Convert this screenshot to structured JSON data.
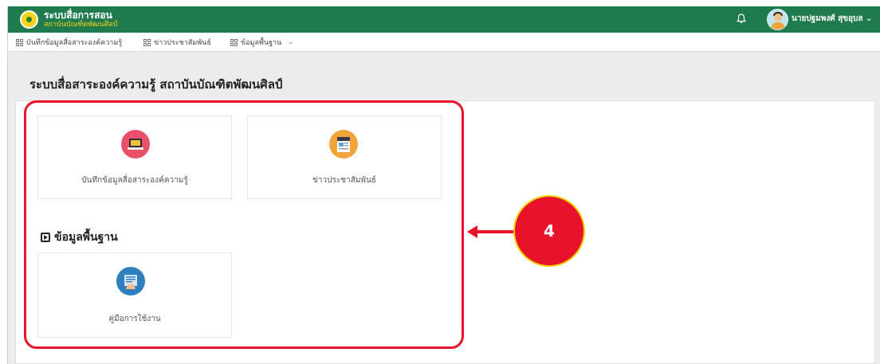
{
  "header": {
    "brand_title": "ระบบสื่อการสอน",
    "brand_subtitle": "สถาบันบัณฑิตพัฒนศิลป์",
    "user_name": "นายปฐมพงศ์ สุขอุบล"
  },
  "menu": [
    {
      "label": "บันทึกข้อมูลสื่อสาระองค์ความรู้"
    },
    {
      "label": "ข่าวประชาสัมพันธ์"
    },
    {
      "label": "ข้อมูลพื้นฐาน"
    }
  ],
  "page": {
    "title": "ระบบสื่อสาระองค์ความรู้ สถาบันบัณฑิตพัฒนศิลป์"
  },
  "cards": [
    {
      "label": "บันทึกข้อมูลสื่อสาระองค์ความรู้",
      "icon": "laptop-icon",
      "color": "#e9506a"
    },
    {
      "label": "ข่าวประชาสัมพันธ์",
      "icon": "news-icon",
      "color": "#f2a43a"
    }
  ],
  "section": {
    "title": "ข้อมูลพื้นฐาน"
  },
  "basic_cards": [
    {
      "label": "คู่มือการใช้งาน",
      "icon": "manual-icon",
      "color": "#2f7fbf"
    }
  ],
  "annotation": {
    "number": "4",
    "color": "#e8132a",
    "badge_border": "#f3d000"
  },
  "colors": {
    "topbar": "#1f7a4d",
    "brand_accent": "#f5d31c"
  }
}
